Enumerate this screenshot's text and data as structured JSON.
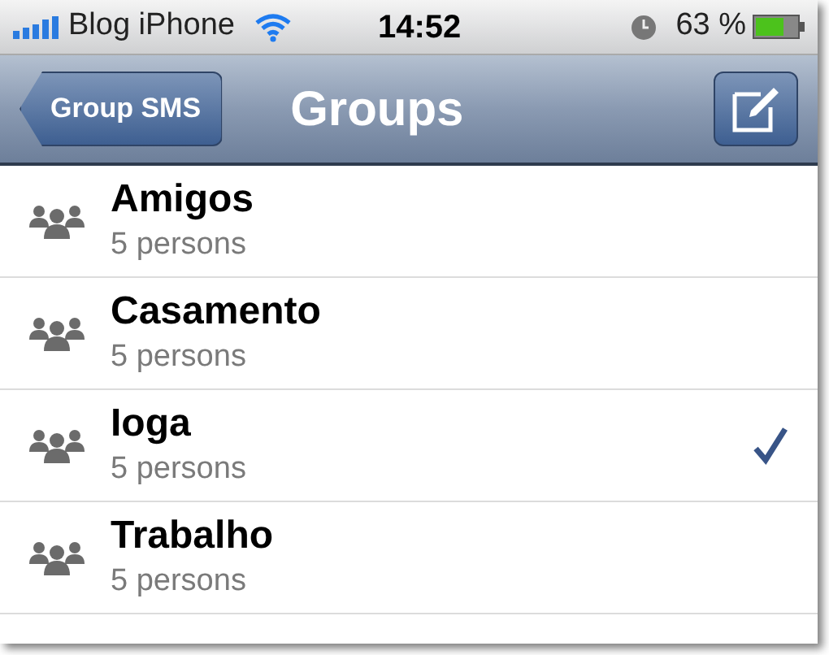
{
  "status_bar": {
    "carrier": "Blog iPhone",
    "time": "14:52",
    "battery": "63 %"
  },
  "nav_bar": {
    "back_button": "Group SMS",
    "title": "Groups"
  },
  "groups": [
    {
      "name": "Amigos",
      "count": "5 persons",
      "selected": false
    },
    {
      "name": "Casamento",
      "count": "5 persons",
      "selected": false
    },
    {
      "name": "Ioga",
      "count": "5 persons",
      "selected": true
    },
    {
      "name": "Trabalho",
      "count": "5 persons",
      "selected": false
    }
  ]
}
